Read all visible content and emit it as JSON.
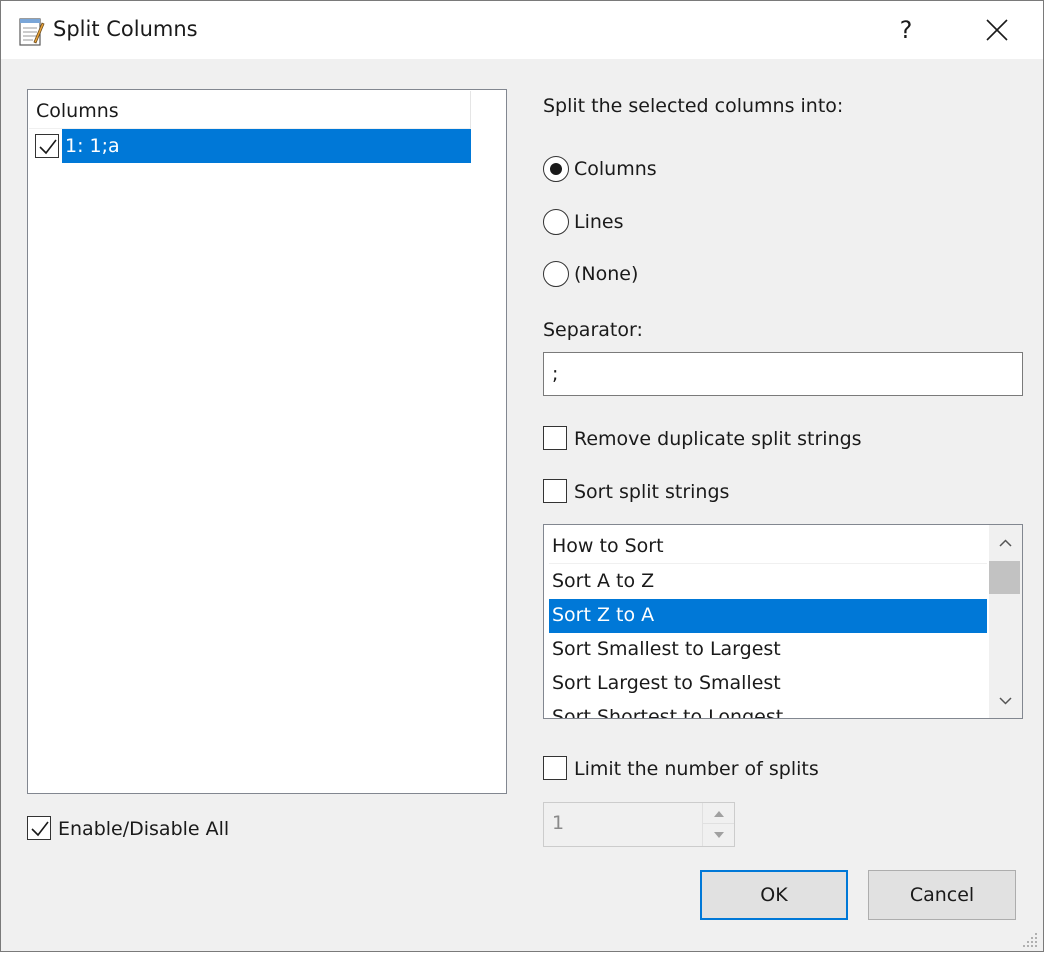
{
  "window": {
    "title": "Split Columns",
    "help_label": "?"
  },
  "columns_list": {
    "header": "Columns",
    "items": [
      {
        "label": "1: 1;a",
        "checked": true,
        "selected": true
      }
    ]
  },
  "enable_all": {
    "label": "Enable/Disable All",
    "checked": true
  },
  "split": {
    "prompt": "Split the selected columns into:",
    "options": [
      {
        "label": "Columns",
        "selected": true
      },
      {
        "label": "Lines",
        "selected": false
      },
      {
        "label": "(None)",
        "selected": false
      }
    ]
  },
  "separator": {
    "label": "Separator:",
    "value": ";"
  },
  "remove_duplicates": {
    "label": "Remove duplicate split strings",
    "checked": false
  },
  "sort_strings": {
    "label": "Sort split strings",
    "checked": false
  },
  "sort_list": {
    "header": "How to Sort",
    "items": [
      {
        "label": "Sort A to Z",
        "selected": false
      },
      {
        "label": "Sort Z to A",
        "selected": true
      },
      {
        "label": "Sort Smallest to Largest",
        "selected": false
      },
      {
        "label": "Sort Largest to Smallest",
        "selected": false
      },
      {
        "label": "Sort Shortest to Longest",
        "selected": false
      }
    ]
  },
  "limit_splits": {
    "label": "Limit the number of splits",
    "checked": false,
    "value": "1"
  },
  "buttons": {
    "ok": "OK",
    "cancel": "Cancel"
  },
  "colors": {
    "accent": "#0078d7",
    "background": "#f0f0f0"
  }
}
